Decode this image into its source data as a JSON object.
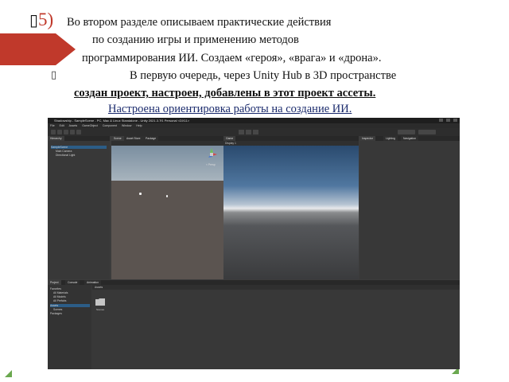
{
  "slide": {
    "number": "5)",
    "line1": "Во    втором    разделе   описываем   практические    действия",
    "line2": "по   созданию  игры       и       применению методов",
    "line3": "программирования ИИ. Создаем «героя», «врага» и «дрона».",
    "line4": "В первую очередь, через Unity Hub в 3D пространстве",
    "line5": "создан проект, настроен, добавлены в этот проект ассеты.",
    "line6": "Настроена ориентировка работы на создание ИИ."
  },
  "colors": {
    "accent_red": "#c0392b",
    "deco_green": "#6aa84f"
  },
  "unity": {
    "title": "Shadowship - SampleScene - PC, Mac & Linux Standalone - Unity 2021.3.7f1 Personal <DX11>",
    "menu": [
      "File",
      "Edit",
      "Assets",
      "GameObject",
      "Component",
      "Window",
      "Help"
    ],
    "tabs": {
      "hierarchy": "Hierarchy",
      "scene": "Scene",
      "asset_store": "Asset Store",
      "package": "Package",
      "game": "Game",
      "inspector": "Inspector",
      "lighting": "Lighting",
      "navigation": "Navigation",
      "project": "Project",
      "console": "Console",
      "animation": "Animation"
    },
    "hierarchy": {
      "scene": "SampleScene",
      "items": [
        "Main Camera",
        "Directional Light"
      ]
    },
    "scene_persp": "< Persp",
    "game_display": "Display 1",
    "project": {
      "tree": [
        "Favorites",
        "All Materials",
        "All Models",
        "All Prefabs",
        "Assets",
        "Scenes",
        "Packages"
      ],
      "breadcrumb": "Assets",
      "folder": "Scenes"
    }
  }
}
